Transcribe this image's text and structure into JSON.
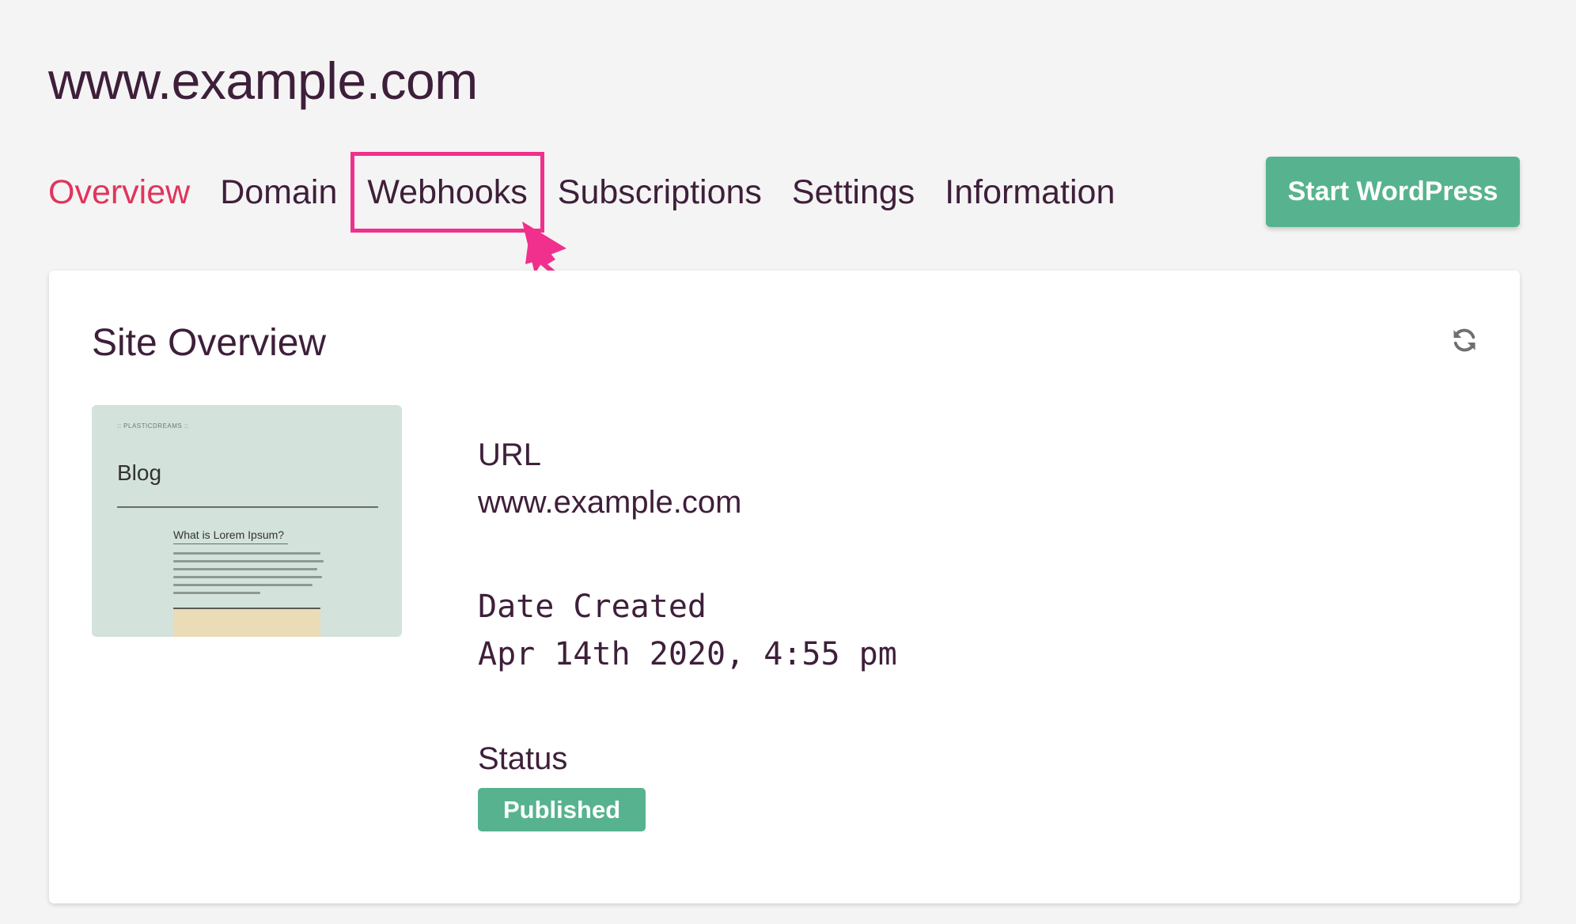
{
  "header": {
    "site_title": "www.example.com"
  },
  "tabs": [
    {
      "label": "Overview",
      "active": true
    },
    {
      "label": "Domain",
      "active": false
    },
    {
      "label": "Webhooks",
      "active": false,
      "highlighted": true
    },
    {
      "label": "Subscriptions",
      "active": false
    },
    {
      "label": "Settings",
      "active": false
    },
    {
      "label": "Information",
      "active": false
    }
  ],
  "actions": {
    "start_wordpress_label": "Start WordPress"
  },
  "card": {
    "title": "Site Overview",
    "refresh_icon": "refresh-icon",
    "thumbnail": {
      "brand": ":: PLASTICDREAMS ::",
      "blog_heading": "Blog",
      "post_title": "What is Lorem Ipsum?"
    },
    "url_label": "URL",
    "url_value": "www.example.com",
    "date_label": "Date Created",
    "date_value": "Apr 14th 2020, 4:55 pm",
    "status_label": "Status",
    "status_value": "Published"
  },
  "colors": {
    "accent_active_tab": "#e0355c",
    "highlight": "#f0308c",
    "button_green": "#57b38f",
    "text": "#3e1f3a",
    "background": "#f4f4f4"
  }
}
